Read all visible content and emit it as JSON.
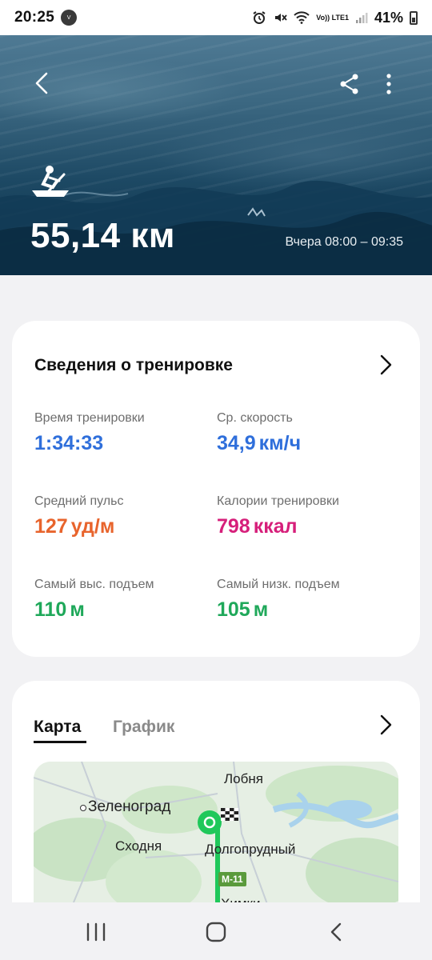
{
  "status_bar": {
    "time": "20:25",
    "app_badge": "Vinted",
    "network": "Vo)) LTE1",
    "battery": "41%"
  },
  "hero": {
    "distance": "55,14 км",
    "time_range": "Вчера 08:00 – 09:35",
    "sport_icon": "rowing-icon"
  },
  "details": {
    "title": "Сведения о тренировке",
    "stats": [
      {
        "label": "Время тренировки",
        "value": "1:34:33",
        "unit": "",
        "color": "#2f6fdb"
      },
      {
        "label": "Ср. скорость",
        "value": "34,9",
        "unit": "км/ч",
        "color": "#2f6fdb"
      },
      {
        "label": "Средний пульс",
        "value": "127",
        "unit": "уд/м",
        "color": "#e8642c"
      },
      {
        "label": "Калории тренировки",
        "value": "798",
        "unit": "ккал",
        "color": "#d61f7a"
      },
      {
        "label": "Самый выс. подъем",
        "value": "110",
        "unit": "м",
        "color": "#1fa85a"
      },
      {
        "label": "Самый низк. подъем",
        "value": "105",
        "unit": "м",
        "color": "#1fa85a"
      }
    ]
  },
  "map_card": {
    "tabs": [
      "Карта",
      "График"
    ],
    "active_tab": "Карта",
    "places": [
      "Лобня",
      "Зеленоград",
      "Сходня",
      "Долгопрудный",
      "М-11",
      "Химки"
    ]
  },
  "nav": {
    "recent_icon": "recent-apps-icon",
    "home_icon": "home-icon",
    "back_icon": "back-icon"
  }
}
